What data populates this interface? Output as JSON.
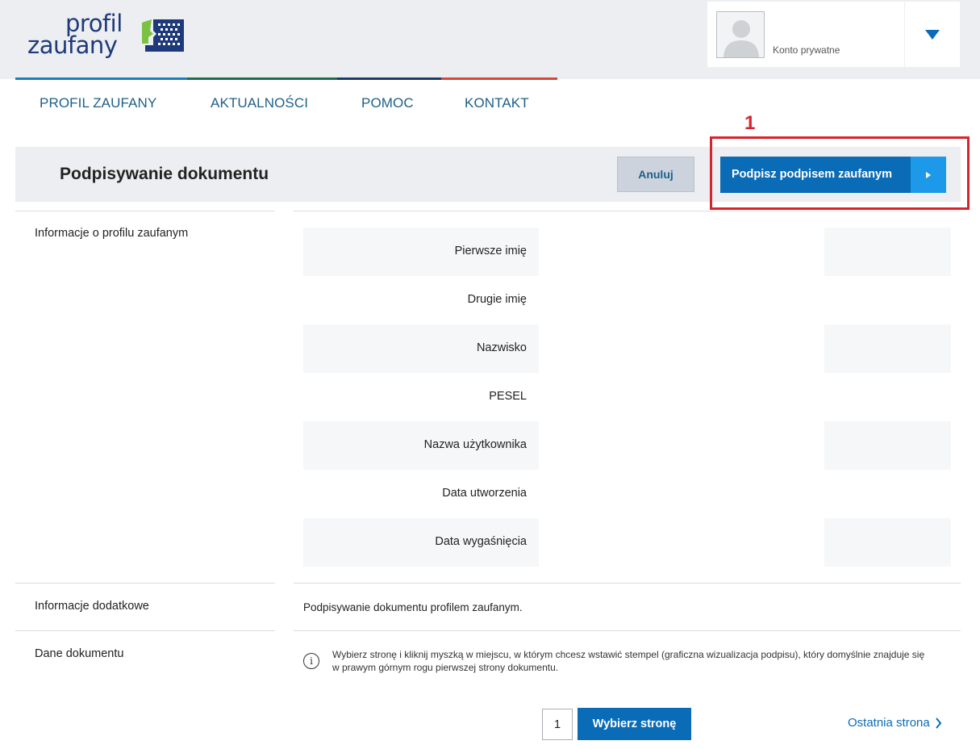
{
  "logo": {
    "line1": "profil",
    "line2": "zaufany"
  },
  "account": {
    "label": "Konto prywatne"
  },
  "nav": {
    "items": [
      {
        "label": "PROFIL ZAUFANY"
      },
      {
        "label": "AKTUALNOŚCI"
      },
      {
        "label": "POMOC"
      },
      {
        "label": "KONTAKT"
      }
    ]
  },
  "colors": {
    "strip": [
      "#1a7fb8",
      "#1f6b4f",
      "#1e3a6b",
      "#d8453a"
    ],
    "primary": "#0a6cb7",
    "annotation": "#d8242e"
  },
  "annotation": {
    "number": "1"
  },
  "titlebar": {
    "title": "Podpisywanie dokumentu",
    "cancel_label": "Anuluj",
    "sign_label": "Podpisz podpisem zaufanym"
  },
  "sections": {
    "profile_info": "Informacje o profilu zaufanym",
    "additional_info": "Informacje dodatkowe",
    "document_data": "Dane dokumentu"
  },
  "profile_fields": [
    {
      "label": "Pierwsze imię"
    },
    {
      "label": "Drugie imię"
    },
    {
      "label": "Nazwisko"
    },
    {
      "label": "PESEL"
    },
    {
      "label": "Nazwa użytkownika"
    },
    {
      "label": "Data utworzenia"
    },
    {
      "label": "Data wygaśnięcia"
    }
  ],
  "additional_text": "Podpisywanie dokumentu profilem zaufanym.",
  "document": {
    "note": "Wybierz stronę i kliknij myszką w miejscu, w którym chcesz wstawić stempel (graficzna wizualizacja podpisu), który domyślnie znajduje się w prawym górnym rogu pierwszej strony dokumentu.",
    "page_value": "1",
    "choose_page_label": "Wybierz stronę",
    "last_page_label": "Ostatnia strona"
  }
}
